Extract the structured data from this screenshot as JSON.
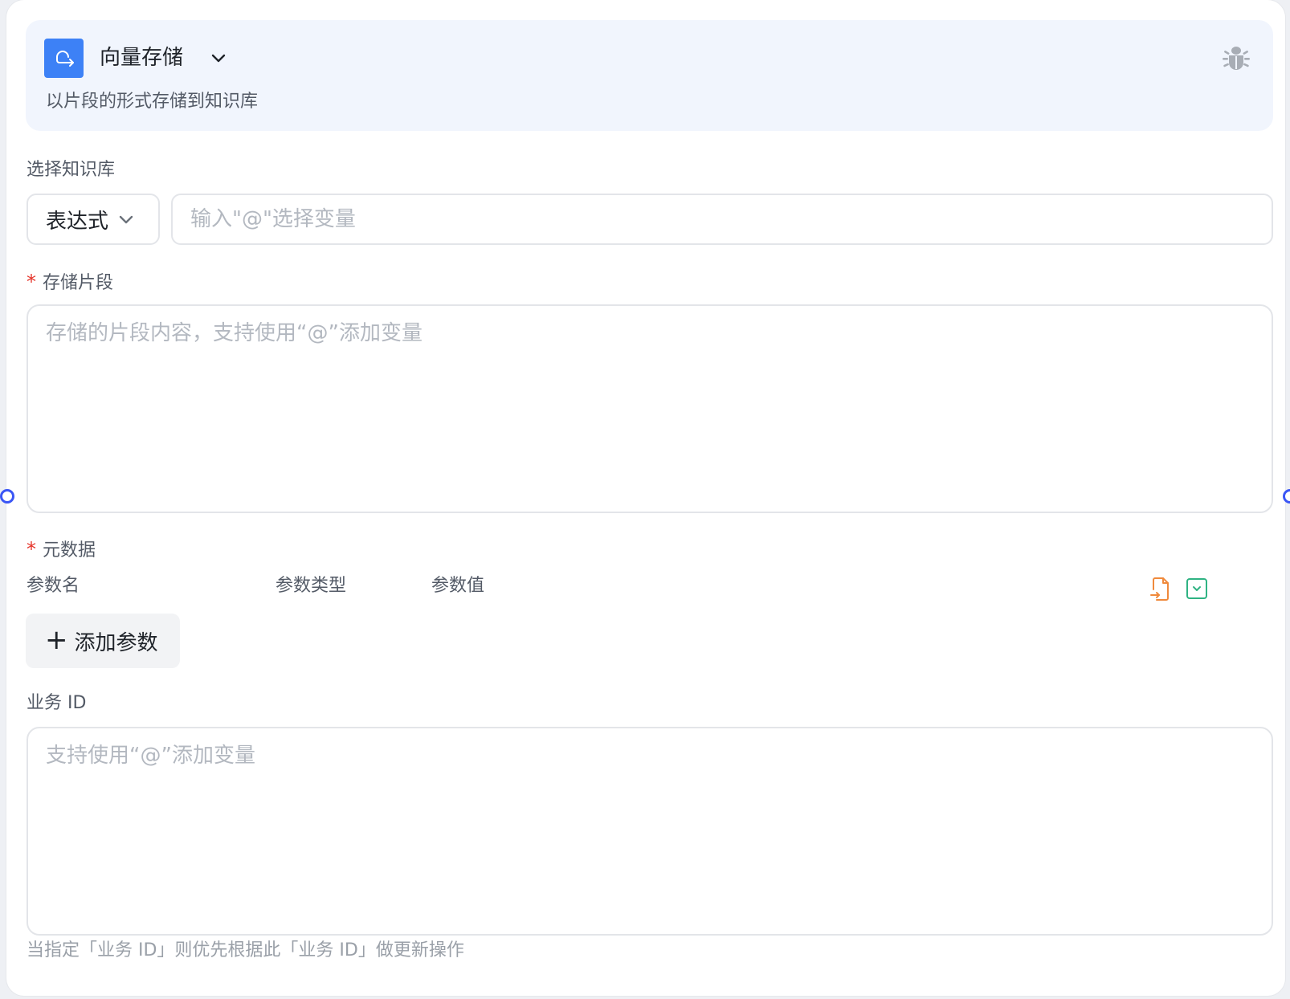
{
  "node": {
    "title": "向量存储",
    "description": "以片段的形式存储到知识库"
  },
  "knowledge_base": {
    "label": "选择知识库",
    "mode_value": "表达式",
    "input_placeholder": "输入\"@\"选择变量"
  },
  "fragment": {
    "required_mark": "*",
    "label": "存储片段",
    "placeholder": "存储的片段内容，支持使用“@”添加变量"
  },
  "metadata": {
    "required_mark": "*",
    "label": "元数据",
    "columns": [
      "参数名",
      "参数类型",
      "参数值"
    ],
    "add_label": "添加参数",
    "add_plus": "+"
  },
  "business_id": {
    "label": "业务 ID",
    "placeholder": "支持使用“@”添加变量",
    "hint": "当指定「业务 ID」则优先根据此「业务 ID」做更新操作"
  },
  "icons": {
    "node": "vector-store-icon",
    "title_dropdown": "chevron-down-icon",
    "debug": "bug-icon",
    "import": "file-import-icon",
    "collapse": "square-chevron-icon"
  },
  "colors": {
    "accent": "#3d81f6",
    "handle": "#3a56f5",
    "required": "#e5352b",
    "import_icon": "#f08a3c",
    "collapse_icon": "#2fb383"
  }
}
